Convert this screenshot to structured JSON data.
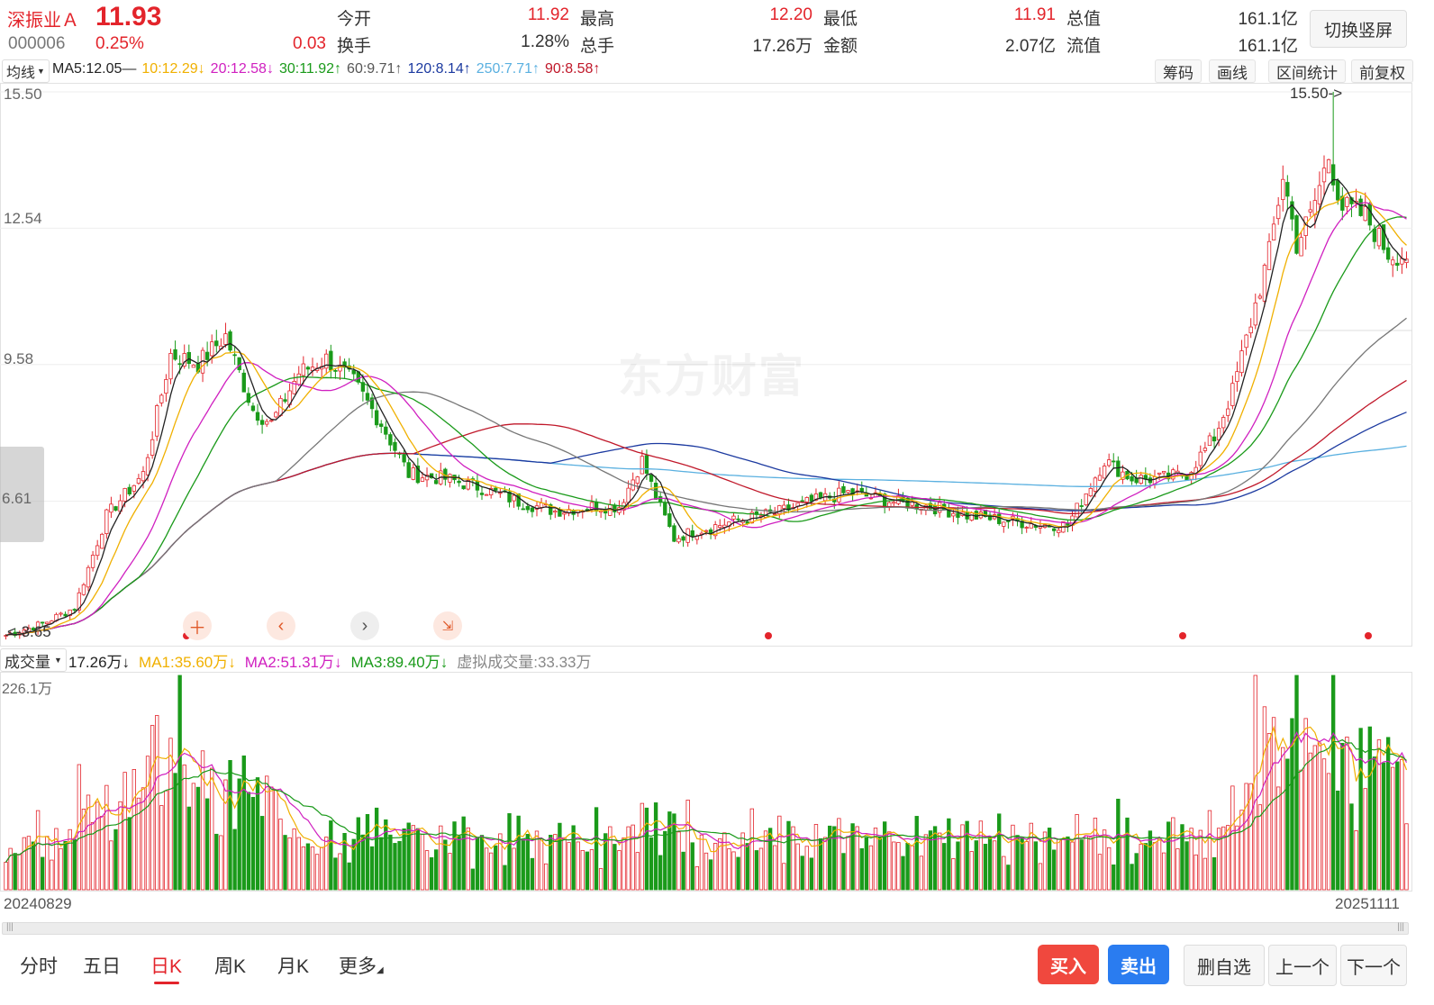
{
  "stock": {
    "name": "深振业Ａ",
    "price": "11.93",
    "code": "000006",
    "pct": "0.25%",
    "change": "0.03"
  },
  "stats": [
    {
      "label": "今开",
      "value": "11.92",
      "color": "#e3242b"
    },
    {
      "label": "最高",
      "value": "12.20",
      "color": "#e3242b"
    },
    {
      "label": "最低",
      "value": "11.91",
      "color": "#e3242b"
    },
    {
      "label": "总值",
      "value": "161.1亿",
      "color": "#333333"
    },
    {
      "label": "换手",
      "value": "1.28%",
      "color": "#333333"
    },
    {
      "label": "总手",
      "value": "17.26万",
      "color": "#333333"
    },
    {
      "label": "金额",
      "value": "2.07亿",
      "color": "#333333"
    },
    {
      "label": "流值",
      "value": "161.1亿",
      "color": "#333333"
    }
  ],
  "switch_button": "切换竖屏",
  "ma_selector": "均线",
  "ma_items": [
    {
      "text": "MA5:12.05—",
      "color": "#222222"
    },
    {
      "text": "10:12.29↓",
      "color": "#f0b000"
    },
    {
      "text": "20:12.58↓",
      "color": "#d020c0"
    },
    {
      "text": "30:11.92↑",
      "color": "#1a9a1a"
    },
    {
      "text": "60:9.71↑",
      "color": "#555555"
    },
    {
      "text": "120:8.14↑",
      "color": "#1c3aa0"
    },
    {
      "text": "250:7.71↑",
      "color": "#5ab0e0"
    },
    {
      "text": "90:8.58↑",
      "color": "#c0182a"
    }
  ],
  "tools": [
    "筹码",
    "画线",
    "区间统计",
    "前复权"
  ],
  "price_axis": [
    "15.50",
    "12.54",
    "9.58",
    "6.61"
  ],
  "max_marker": "15.50->",
  "min_marker": "3.65",
  "watermark": "东方财富",
  "volume": {
    "selector": "成交量",
    "items": [
      {
        "text": "17.26万↓",
        "color": "#222222"
      },
      {
        "text": "MA1:35.60万↓",
        "color": "#f0b000"
      },
      {
        "text": "MA2:51.31万↓",
        "color": "#d020c0"
      },
      {
        "text": "MA3:89.40万↓",
        "color": "#1a9a1a"
      },
      {
        "text": "虚拟成交量:33.33万",
        "color": "#888888"
      }
    ],
    "max_label": "226.1万"
  },
  "dates": {
    "start": "20240829",
    "end": "20251111"
  },
  "tabs": [
    {
      "label": "分时",
      "active": false
    },
    {
      "label": "五日",
      "active": false
    },
    {
      "label": "日K",
      "active": true
    },
    {
      "label": "周K",
      "active": false
    },
    {
      "label": "月K",
      "active": false
    },
    {
      "label": "更多",
      "active": false
    }
  ],
  "actions": {
    "buy": "买入",
    "sell": "卖出",
    "remove": "删自选",
    "prev": "上一个",
    "next": "下一个"
  },
  "chart_data": {
    "type": "candlestick",
    "ylim": [
      3.65,
      15.5
    ],
    "anchors": [
      [
        0,
        3.7
      ],
      [
        8,
        3.95
      ],
      [
        15,
        4.3
      ],
      [
        22,
        6.3
      ],
      [
        30,
        7.2
      ],
      [
        36,
        9.8
      ],
      [
        42,
        9.6
      ],
      [
        48,
        10.2
      ],
      [
        54,
        8.6
      ],
      [
        58,
        8.3
      ],
      [
        64,
        9.4
      ],
      [
        70,
        9.7
      ],
      [
        76,
        9.2
      ],
      [
        82,
        8.3
      ],
      [
        88,
        7.2
      ],
      [
        96,
        7.1
      ],
      [
        104,
        6.9
      ],
      [
        112,
        6.6
      ],
      [
        120,
        6.4
      ],
      [
        128,
        6.5
      ],
      [
        134,
        6.5
      ],
      [
        139,
        7.5
      ],
      [
        142,
        6.7
      ],
      [
        146,
        5.8
      ],
      [
        150,
        5.95
      ],
      [
        160,
        6.2
      ],
      [
        168,
        6.35
      ],
      [
        176,
        6.6
      ],
      [
        184,
        6.8
      ],
      [
        194,
        6.6
      ],
      [
        202,
        6.5
      ],
      [
        210,
        6.3
      ],
      [
        218,
        6.2
      ],
      [
        226,
        6.1
      ],
      [
        232,
        6.1
      ],
      [
        236,
        6.8
      ],
      [
        240,
        7.5
      ],
      [
        246,
        7.1
      ],
      [
        252,
        7.1
      ],
      [
        258,
        7.2
      ],
      [
        264,
        8.0
      ],
      [
        268,
        9.0
      ],
      [
        272,
        10.5
      ],
      [
        276,
        12.0
      ],
      [
        279,
        13.7
      ],
      [
        282,
        12.2
      ],
      [
        285,
        12.8
      ],
      [
        289,
        14.1
      ],
      [
        292,
        13.0
      ],
      [
        297,
        12.8
      ],
      [
        302,
        12.0
      ],
      [
        306,
        11.95
      ]
    ],
    "ma_periods": [
      5,
      10,
      20,
      30,
      60,
      90,
      120,
      250
    ]
  }
}
